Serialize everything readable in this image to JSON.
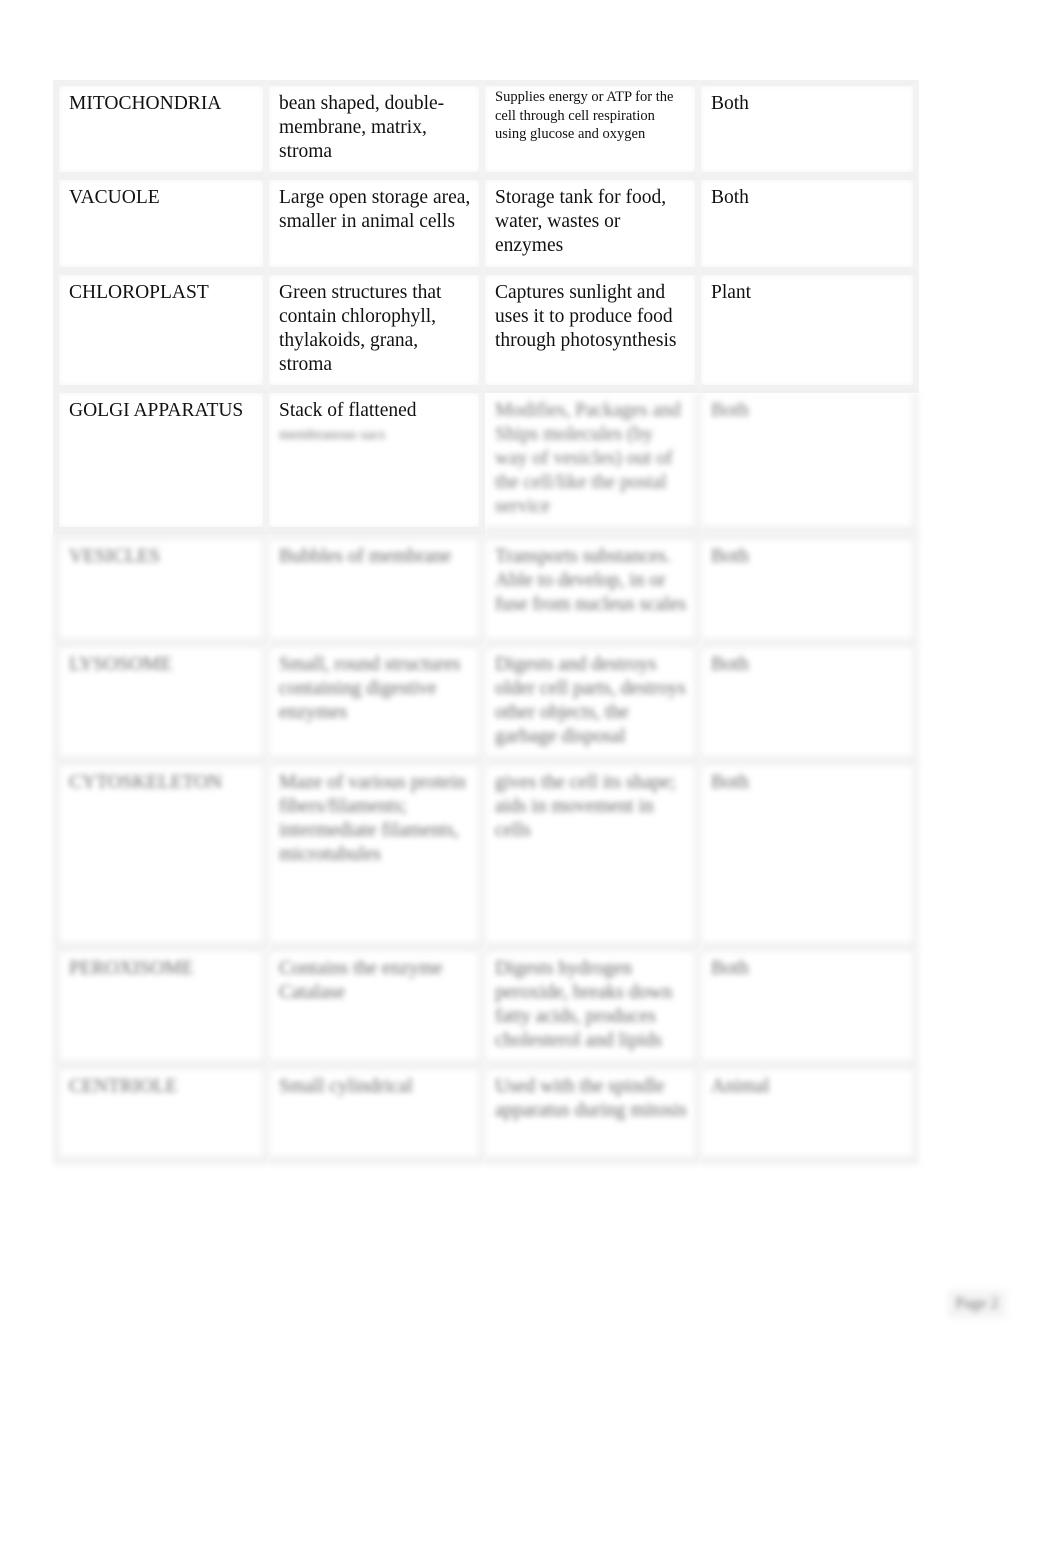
{
  "organelle_table": {
    "rows": [
      {
        "organelle": "MITOCHONDRIA",
        "structure": "bean shaped, double-membrane, matrix, stroma",
        "function": "Supplies energy or ATP for the cell through cell respiration using glucose and oxygen",
        "cell_type": "Both",
        "blurred": false
      },
      {
        "organelle": "VACUOLE",
        "structure": "Large open storage area, smaller in animal cells",
        "function": "Storage tank for food, water, wastes or enzymes",
        "cell_type": "Both",
        "blurred": false
      },
      {
        "organelle": "CHLOROPLAST",
        "structure": "Green structures that contain chlorophyll, thylakoids, grana, stroma",
        "function": "Captures sunlight and uses it to produce food through photosynthesis",
        "cell_type": "Plant",
        "blurred": false
      },
      {
        "organelle": "GOLGI APPARATUS",
        "structure": "Stack of flattened",
        "structure_hidden": "membranous sacs",
        "function": "Modifies, Packages and Ships molecules (by way of vesicles) out of the cell/like the postal service",
        "cell_type": "Both",
        "blurred": "partial"
      },
      {
        "organelle": "VESICLES",
        "structure": "Bubbles of membrane",
        "function": "Transports substances. Able to develop, in or fuse from nucleus scales",
        "cell_type": "Both",
        "blurred": true
      },
      {
        "organelle": "LYSOSOME",
        "structure": "Small, round structures containing digestive enzymes",
        "function": "Digests and destroys older cell parts, destroys other objects, the garbage disposal",
        "cell_type": "Both",
        "blurred": true
      },
      {
        "organelle": "CYTOSKELETON",
        "structure": "Maze of various protein fibers/filaments; intermediate filaments, microtubules",
        "function": "gives the cell its shape; aids in movement in cells",
        "cell_type": "Both",
        "blurred": true
      },
      {
        "organelle": "PEROXISOME",
        "structure": "Contains the enzyme Catalase",
        "function": "Digests hydrogen peroxide, breaks down fatty acids, produces cholesterol and lipids",
        "cell_type": "Both",
        "blurred": true
      },
      {
        "organelle": "CENTRIOLE",
        "structure": "Small cylindrical",
        "function": "Used with the spindle apparatus during mitosis",
        "cell_type": "Animal",
        "blurred": true
      }
    ]
  },
  "footer": {
    "page_label": "Page 2"
  }
}
